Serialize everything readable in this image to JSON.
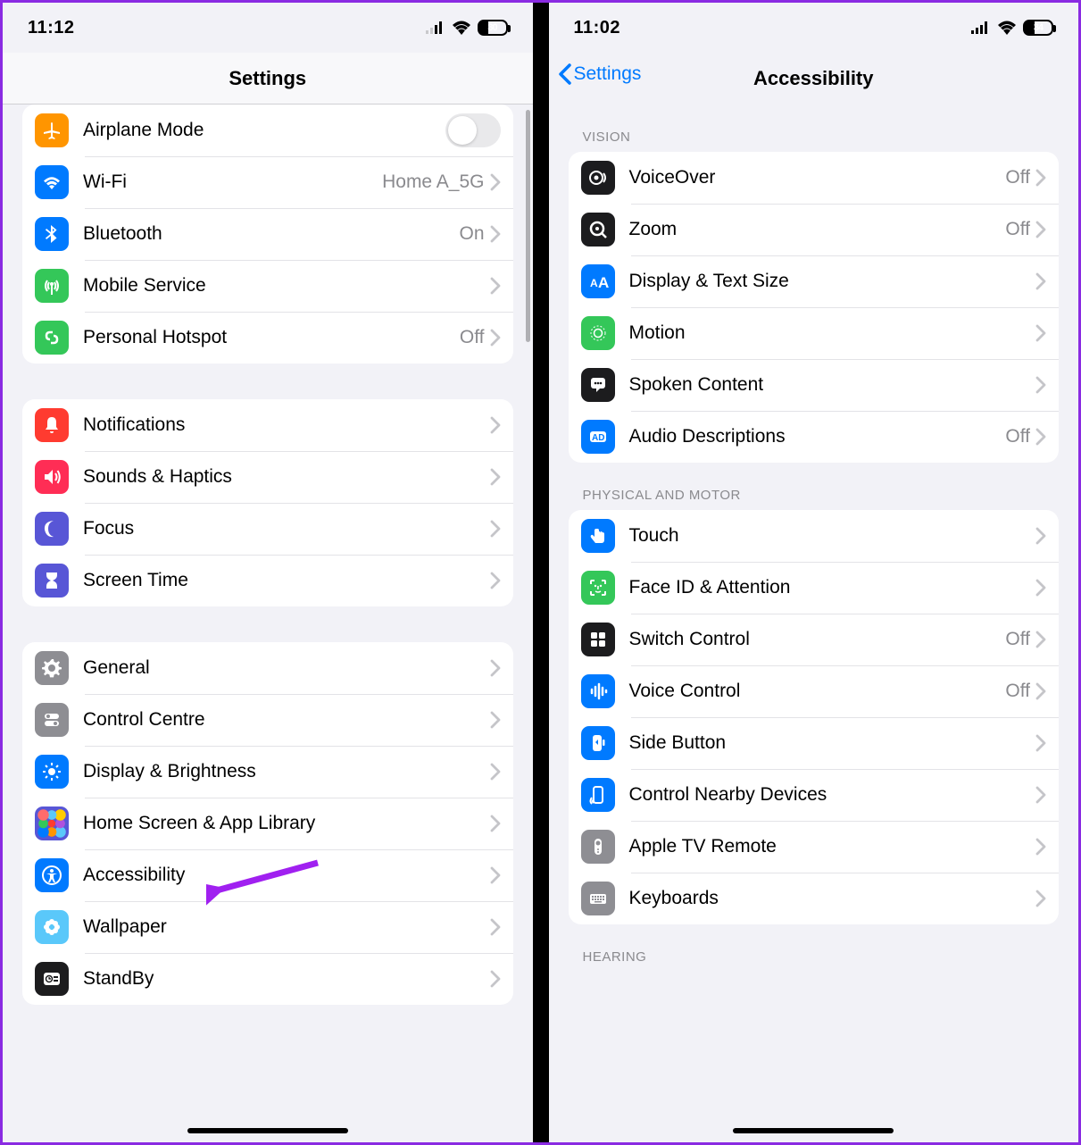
{
  "left": {
    "status": {
      "time": "11:12",
      "battery_pct": "30"
    },
    "title": "Settings",
    "groups": [
      {
        "rows": [
          {
            "icon": "airplane-icon",
            "name": "row-airplane",
            "label": "Airplane Mode",
            "control": "toggle",
            "toggle_on": false,
            "color": "bg-orange"
          },
          {
            "icon": "wifi-icon",
            "name": "row-wifi",
            "label": "Wi-Fi",
            "value": "Home A_5G",
            "chevron": true,
            "color": "bg-blue"
          },
          {
            "icon": "bluetooth-icon",
            "name": "row-bluetooth",
            "label": "Bluetooth",
            "value": "On",
            "chevron": true,
            "color": "bg-blue"
          },
          {
            "icon": "antenna-icon",
            "name": "row-mobile-service",
            "label": "Mobile Service",
            "chevron": true,
            "color": "bg-green"
          },
          {
            "icon": "link-icon",
            "name": "row-personal-hotspot",
            "label": "Personal Hotspot",
            "value": "Off",
            "chevron": true,
            "color": "bg-green"
          }
        ]
      },
      {
        "rows": [
          {
            "icon": "bell-icon",
            "name": "row-notifications",
            "label": "Notifications",
            "chevron": true,
            "color": "bg-red"
          },
          {
            "icon": "speaker-icon",
            "name": "row-sounds",
            "label": "Sounds & Haptics",
            "chevron": true,
            "color": "bg-pink"
          },
          {
            "icon": "moon-icon",
            "name": "row-focus",
            "label": "Focus",
            "chevron": true,
            "color": "bg-indigo"
          },
          {
            "icon": "hourglass-icon",
            "name": "row-screentime",
            "label": "Screen Time",
            "chevron": true,
            "color": "bg-indigo"
          }
        ]
      },
      {
        "rows": [
          {
            "icon": "gear-icon",
            "name": "row-general",
            "label": "General",
            "chevron": true,
            "color": "bg-gray"
          },
          {
            "icon": "switches-icon",
            "name": "row-control-centre",
            "label": "Control Centre",
            "chevron": true,
            "color": "bg-gray"
          },
          {
            "icon": "brightness-icon",
            "name": "row-display",
            "label": "Display & Brightness",
            "chevron": true,
            "color": "bg-blue"
          },
          {
            "icon": "apps-grid-icon",
            "name": "row-homescreen",
            "label": "Home Screen & App Library",
            "chevron": true,
            "color": "bg-tile"
          },
          {
            "icon": "accessibility-icon",
            "name": "row-accessibility",
            "label": "Accessibility",
            "chevron": true,
            "color": "bg-blue"
          },
          {
            "icon": "flower-icon",
            "name": "row-wallpaper",
            "label": "Wallpaper",
            "chevron": true,
            "color": "bg-cyan"
          },
          {
            "icon": "clock-icon",
            "name": "row-standby",
            "label": "StandBy",
            "chevron": true,
            "color": "bg-dark"
          }
        ]
      }
    ]
  },
  "right": {
    "status": {
      "time": "11:02",
      "battery_pct": "34"
    },
    "back_label": "Settings",
    "title": "Accessibility",
    "sections": [
      {
        "header": "Vision",
        "rows": [
          {
            "icon": "voiceover-icon",
            "name": "row-voiceover",
            "label": "VoiceOver",
            "value": "Off",
            "chevron": true,
            "color": "bg-dark"
          },
          {
            "icon": "zoom-icon",
            "name": "row-zoom",
            "label": "Zoom",
            "value": "Off",
            "chevron": true,
            "color": "bg-dark"
          },
          {
            "icon": "textsize-icon",
            "name": "row-display-textsize",
            "label": "Display & Text Size",
            "chevron": true,
            "color": "bg-blue"
          },
          {
            "icon": "motion-icon",
            "name": "row-motion",
            "label": "Motion",
            "chevron": true,
            "color": "bg-green"
          },
          {
            "icon": "speech-icon",
            "name": "row-spoken-content",
            "label": "Spoken Content",
            "chevron": true,
            "color": "bg-dark"
          },
          {
            "icon": "audio-desc-icon",
            "name": "row-audio-descriptions",
            "label": "Audio Descriptions",
            "value": "Off",
            "chevron": true,
            "color": "bg-blue"
          }
        ]
      },
      {
        "header": "Physical and Motor",
        "rows": [
          {
            "icon": "touch-icon",
            "name": "row-touch",
            "label": "Touch",
            "chevron": true,
            "color": "bg-blue"
          },
          {
            "icon": "faceid-icon",
            "name": "row-faceid",
            "label": "Face ID & Attention",
            "chevron": true,
            "color": "bg-green"
          },
          {
            "icon": "switch-control-icon",
            "name": "row-switch-control",
            "label": "Switch Control",
            "value": "Off",
            "chevron": true,
            "color": "bg-dark"
          },
          {
            "icon": "voice-control-icon",
            "name": "row-voice-control",
            "label": "Voice Control",
            "value": "Off",
            "chevron": true,
            "color": "bg-blue"
          },
          {
            "icon": "side-button-icon",
            "name": "row-side-button",
            "label": "Side Button",
            "chevron": true,
            "color": "bg-blue"
          },
          {
            "icon": "nearby-icon",
            "name": "row-nearby-devices",
            "label": "Control Nearby Devices",
            "chevron": true,
            "color": "bg-blue"
          },
          {
            "icon": "appletv-icon",
            "name": "row-appletv-remote",
            "label": "Apple TV Remote",
            "chevron": true,
            "color": "bg-gray"
          },
          {
            "icon": "keyboard-icon",
            "name": "row-keyboards",
            "label": "Keyboards",
            "chevron": true,
            "color": "bg-gray"
          }
        ]
      },
      {
        "header": "Hearing",
        "rows": []
      }
    ]
  }
}
